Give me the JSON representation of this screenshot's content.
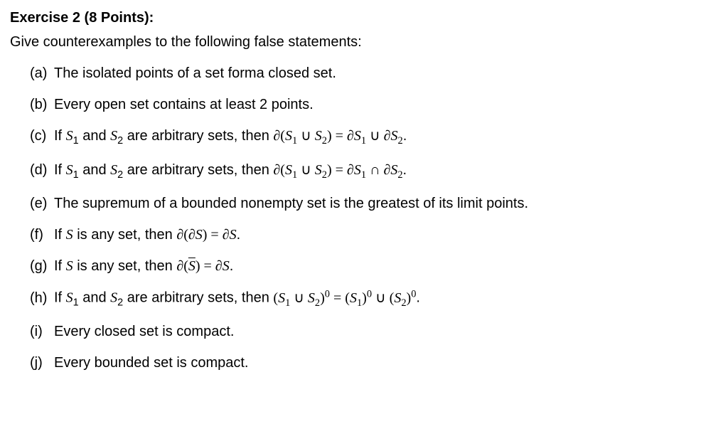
{
  "heading": "Exercise 2  (8 Points):",
  "instruction": "Give counterexamples to the following false statements:",
  "items": [
    {
      "label": "(a)",
      "html": "The isolated points of a set forma closed set."
    },
    {
      "label": "(b)",
      "html": "Every open set contains at least 2 points."
    },
    {
      "label": "(c)",
      "html": "If <span class='mi'>S</span><span class='sub'>1</span> and <span class='mi'>S</span><span class='sub'>2</span> are arbitrary sets, then <span class='math'>∂(<span class='mi'>S</span><span class='sub'>1</span> ∪ <span class='mi'>S</span><span class='sub'>2</span>) = ∂<span class='mi'>S</span><span class='sub'>1</span> ∪ ∂<span class='mi'>S</span><span class='sub'>2</span></span>."
    },
    {
      "label": "(d)",
      "html": "If <span class='mi'>S</span><span class='sub'>1</span> and <span class='mi'>S</span><span class='sub'>2</span> are arbitrary sets, then <span class='math'>∂(<span class='mi'>S</span><span class='sub'>1</span> ∪ <span class='mi'>S</span><span class='sub'>2</span>) = ∂<span class='mi'>S</span><span class='sub'>1</span> ∩ ∂<span class='mi'>S</span><span class='sub'>2</span></span>."
    },
    {
      "label": "(e)",
      "html": "The supremum of a bounded nonempty set is the greatest of its limit points."
    },
    {
      "label": "(f)",
      "html": "If <span class='mi'>S</span> is any set, then <span class='math'>∂(∂<span class='mi'>S</span>) = ∂<span class='mi'>S</span></span>."
    },
    {
      "label": "(g)",
      "html": "If <span class='mi'>S</span> is any set, then <span class='math'>∂(<span class='mi overline'>S</span>) = ∂<span class='mi'>S</span></span>."
    },
    {
      "label": "(h)",
      "html": "If <span class='mi'>S</span><span class='sub'>1</span> and <span class='mi'>S</span><span class='sub'>2</span> are arbitrary sets, then <span class='math'>(<span class='mi'>S</span><span class='sub'>1</span> ∪ <span class='mi'>S</span><span class='sub'>2</span>)<span class='sup'>0</span> = (<span class='mi'>S</span><span class='sub'>1</span>)<span class='sup'>0</span> ∪ (<span class='mi'>S</span><span class='sub'>2</span>)<span class='sup'>0</span></span>."
    },
    {
      "label": "(i)",
      "html": "Every closed set is compact."
    },
    {
      "label": "(j)",
      "html": "Every bounded set is compact."
    }
  ]
}
